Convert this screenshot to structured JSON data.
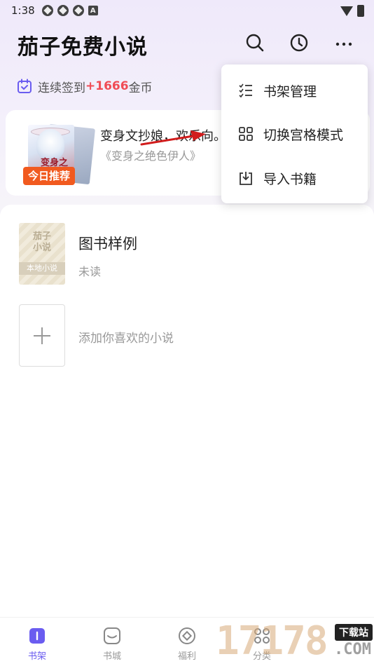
{
  "status_bar": {
    "time": "1:38",
    "notif_letter": "A"
  },
  "header": {
    "title": "茄子免费小说"
  },
  "signin": {
    "prefix": "连续签到",
    "amount": "+1666",
    "suffix": "金币"
  },
  "recommend": {
    "title": "变身文抄娘，欢乐向。",
    "subtitle": "《变身之绝色伊人》",
    "badge": "今日推荐",
    "cover_text": "变身之"
  },
  "bookshelf": {
    "book": {
      "cover_title_line1": "茄子",
      "cover_title_line2": "小说",
      "cover_band": "本地小说",
      "title": "图书样例",
      "status": "未读"
    },
    "add_label": "添加你喜欢的小说"
  },
  "menu": {
    "items": [
      {
        "label": "书架管理",
        "icon": "checklist-icon"
      },
      {
        "label": "切换宫格模式",
        "icon": "grid-icon"
      },
      {
        "label": "导入书籍",
        "icon": "import-icon"
      }
    ]
  },
  "bottom_nav": {
    "items": [
      {
        "label": "书架",
        "icon": "bookshelf-icon",
        "active": true
      },
      {
        "label": "书城",
        "icon": "bookstore-icon"
      },
      {
        "label": "福利",
        "icon": "welfare-icon"
      },
      {
        "label": "分类",
        "icon": "category-icon"
      }
    ]
  },
  "watermark": {
    "digits": "17178",
    "tag": "下载站",
    "domain": ".COM"
  },
  "colors": {
    "accent": "#6a5cf0",
    "coin": "#f04b55",
    "badge": "#f15a1f"
  }
}
